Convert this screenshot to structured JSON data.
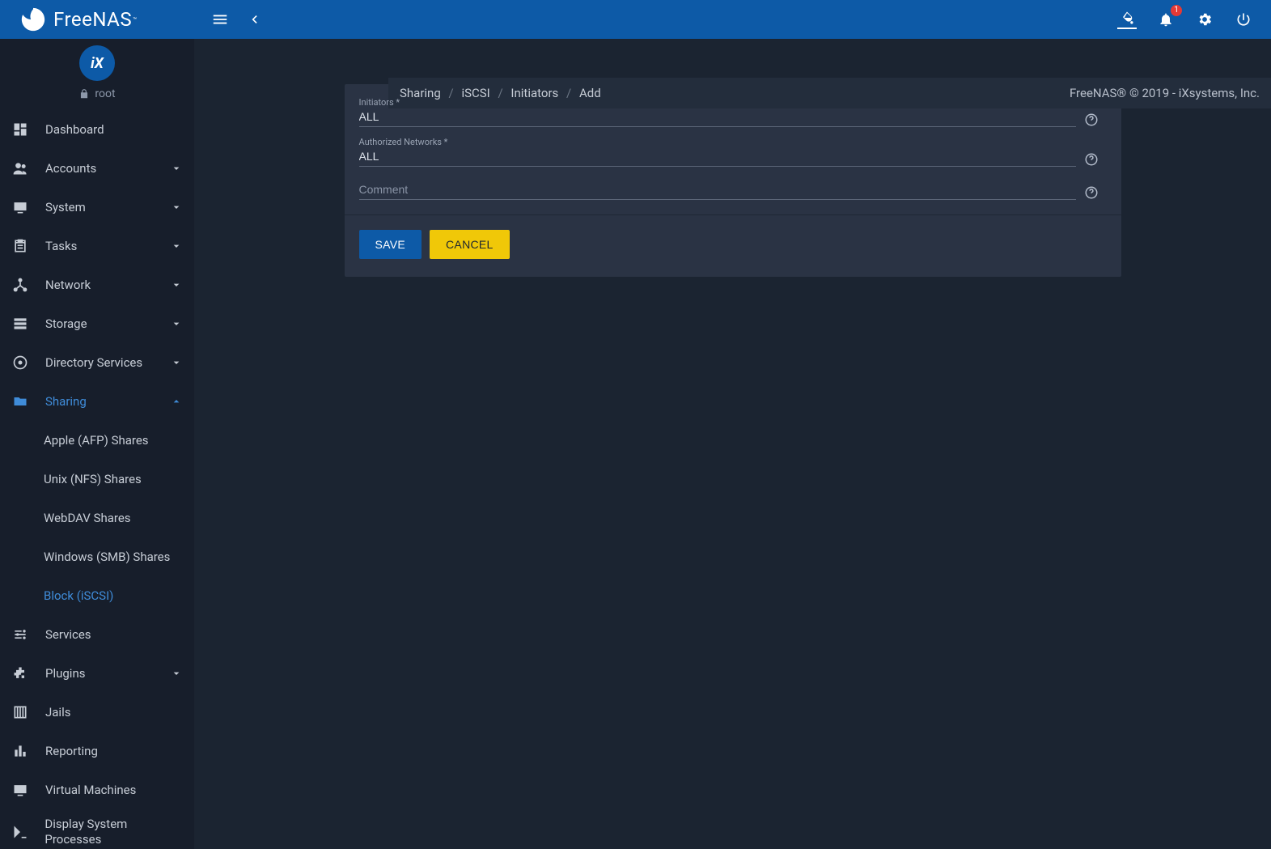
{
  "brand": {
    "name": "FreeNAS",
    "tm": "™"
  },
  "topbar": {
    "notification_count": "1"
  },
  "user": {
    "name": "root",
    "avatar_text": "iX"
  },
  "breadcrumb": {
    "items": [
      "Sharing",
      "iSCSI",
      "Initiators",
      "Add"
    ]
  },
  "copyright": "FreeNAS® © 2019 - iXsystems, Inc.",
  "sidebar": {
    "dashboard": "Dashboard",
    "accounts": "Accounts",
    "system": "System",
    "tasks": "Tasks",
    "network": "Network",
    "storage": "Storage",
    "directory_services": "Directory Services",
    "sharing": "Sharing",
    "sharing_children": {
      "afp": "Apple (AFP) Shares",
      "nfs": "Unix (NFS) Shares",
      "webdav": "WebDAV Shares",
      "smb": "Windows (SMB) Shares",
      "iscsi": "Block (iSCSI)"
    },
    "services": "Services",
    "plugins": "Plugins",
    "jails": "Jails",
    "reporting": "Reporting",
    "vm": "Virtual Machines",
    "processes": "Display System Processes"
  },
  "form": {
    "initiators": {
      "label": "Initiators *",
      "value": "ALL"
    },
    "networks": {
      "label": "Authorized Networks *",
      "value": "ALL"
    },
    "comment": {
      "label": "Comment",
      "value": ""
    },
    "save": "Save",
    "cancel": "Cancel"
  }
}
